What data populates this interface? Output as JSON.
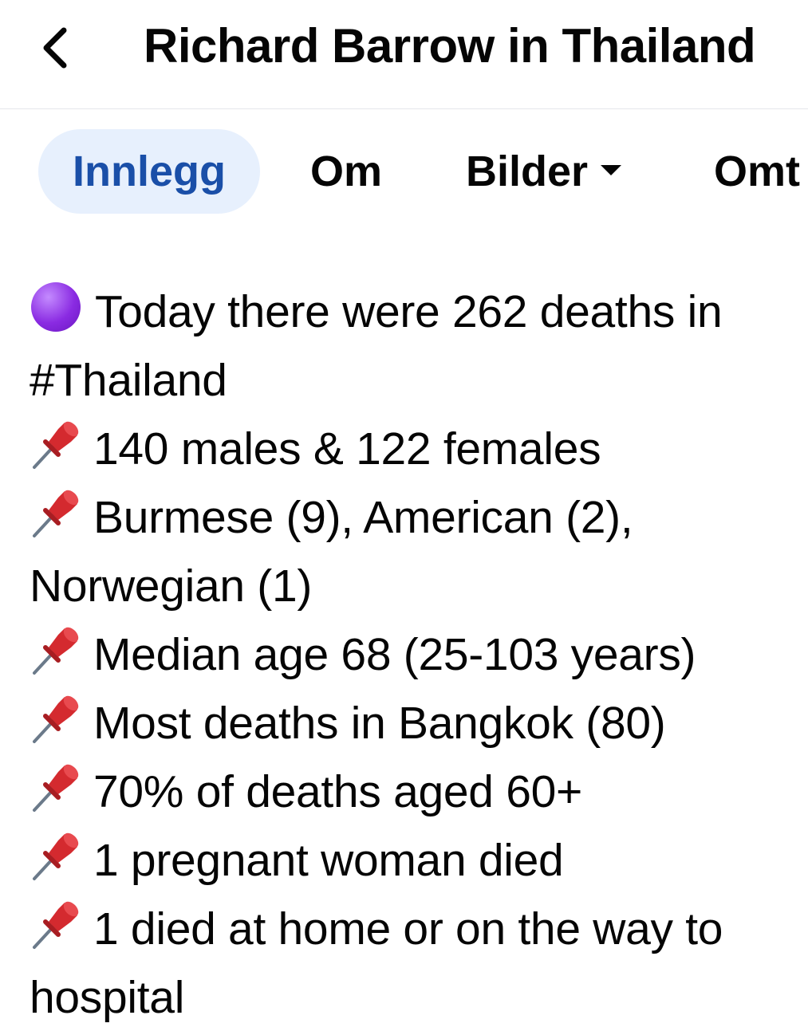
{
  "header": {
    "title": "Richard Barrow in Thailand",
    "back_icon": "chevron-left-icon"
  },
  "tabs": [
    {
      "label": "Innlegg",
      "active": true
    },
    {
      "label": "Om",
      "active": false
    },
    {
      "label": "Bilder",
      "active": false,
      "has_dropdown": true
    },
    {
      "label": "Omt",
      "active": false
    }
  ],
  "post": {
    "lines": [
      {
        "icon": "purple-circle-icon",
        "text": "Today there were 262 deaths in #Thailand"
      },
      {
        "icon": "pushpin-icon",
        "text": "140 males & 122 females"
      },
      {
        "icon": "pushpin-icon",
        "text": "Burmese (9), American (2), Norwegian (1)"
      },
      {
        "icon": "pushpin-icon",
        "text": "Median age 68 (25-103 years)"
      },
      {
        "icon": "pushpin-icon",
        "text": "Most deaths in Bangkok (80)"
      },
      {
        "icon": "pushpin-icon",
        "text": "70% of deaths aged 60+"
      },
      {
        "icon": "pushpin-icon",
        "text": "1 pregnant woman died"
      },
      {
        "icon": "pushpin-icon",
        "text": "1 died at home or on the way to hospital"
      }
    ]
  },
  "colors": {
    "active_tab_bg": "#e7f0fd",
    "active_tab_text": "#1a4fa8",
    "text": "#050505",
    "purple": "#8a2be2",
    "pin_red": "#d42a2f"
  }
}
